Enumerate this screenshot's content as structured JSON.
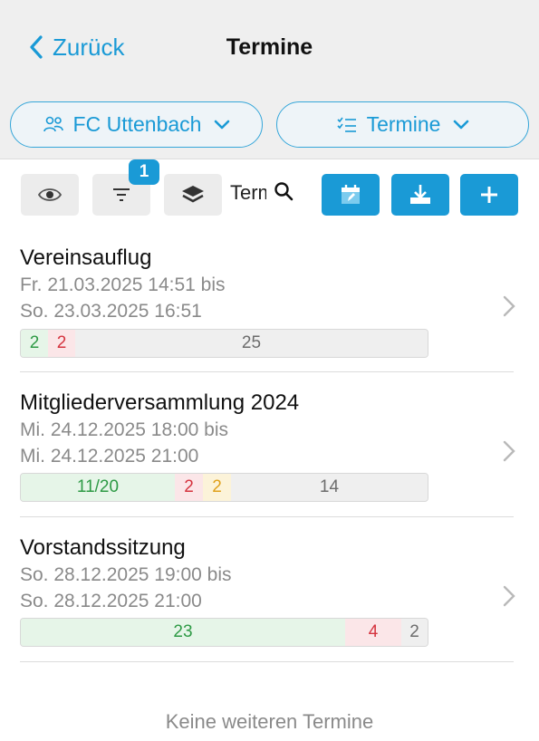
{
  "header": {
    "back_label": "Zurück",
    "title": "Termine"
  },
  "filters": {
    "team": "FC Uttenbach",
    "view": "Termine"
  },
  "toolbar": {
    "filter_badge": "1",
    "search_text": "Termine"
  },
  "events": [
    {
      "name": "Vereinsauflug",
      "date_from": "Fr. 21.03.2025 14:51 bis",
      "date_to": "So. 23.03.2025 16:51",
      "segments": [
        {
          "label": "2",
          "color": "green",
          "share": 0.067
        },
        {
          "label": "2",
          "color": "red",
          "share": 0.067
        },
        {
          "label": "25",
          "color": "grey",
          "share": 0.866
        }
      ]
    },
    {
      "name": "Mitgliederversammlung 2024",
      "date_from": "Mi. 24.12.2025 18:00 bis",
      "date_to": "Mi. 24.12.2025 21:00",
      "segments": [
        {
          "label": "11/20",
          "color": "green",
          "share": 0.378
        },
        {
          "label": "2",
          "color": "red",
          "share": 0.069
        },
        {
          "label": "2",
          "color": "yellow",
          "share": 0.069
        },
        {
          "label": "14",
          "color": "grey",
          "share": 0.484
        }
      ]
    },
    {
      "name": "Vorstandssitzung",
      "date_from": "So. 28.12.2025 19:00 bis",
      "date_to": "So. 28.12.2025 21:00",
      "segments": [
        {
          "label": "23",
          "color": "green",
          "share": 0.793
        },
        {
          "label": "4",
          "color": "red",
          "share": 0.138
        },
        {
          "label": "2",
          "color": "grey",
          "share": 0.069
        }
      ]
    }
  ],
  "footer": "Keine weiteren Termine",
  "colors": {
    "accent": "#1a9ad6",
    "green": "#2e9a45",
    "red": "#d5343f",
    "yellow": "#e0a11b"
  }
}
